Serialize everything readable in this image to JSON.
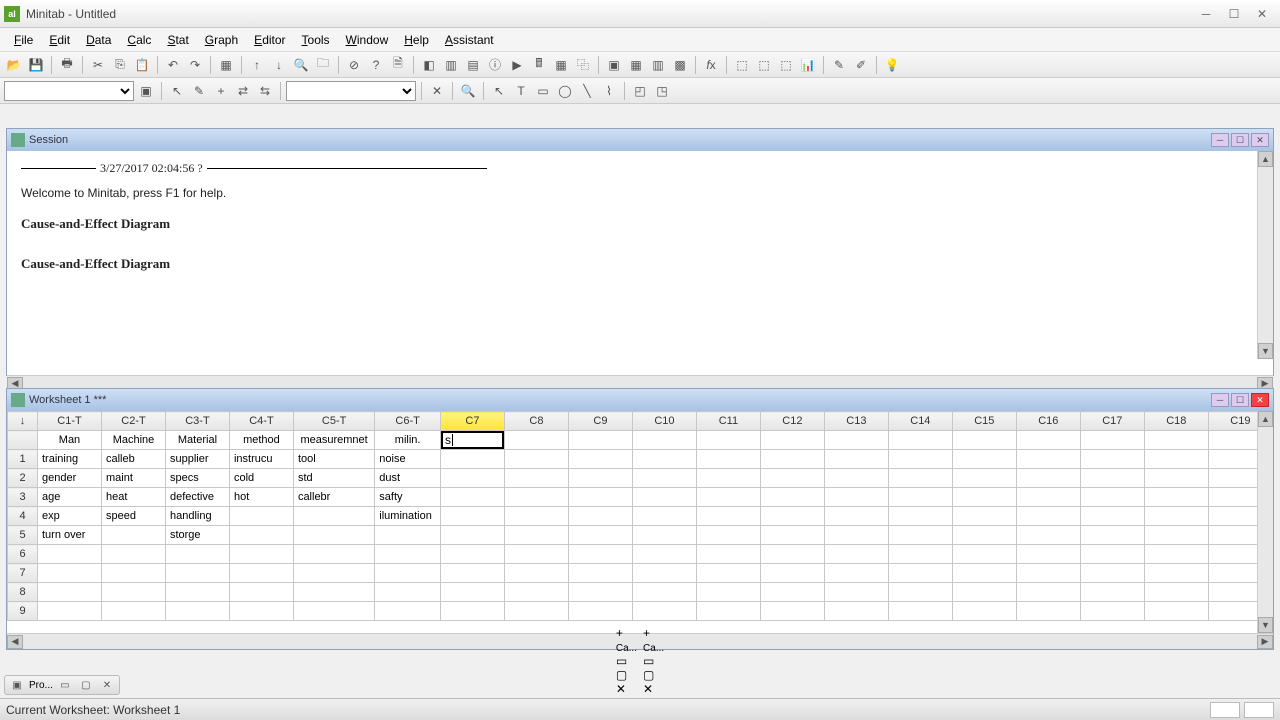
{
  "title": "Minitab - Untitled",
  "menu": [
    "File",
    "Edit",
    "Data",
    "Calc",
    "Stat",
    "Graph",
    "Editor",
    "Tools",
    "Window",
    "Help",
    "Assistant"
  ],
  "session": {
    "title": "Session",
    "timestamp": "3/27/2017 02:04:56 ?",
    "welcome": "Welcome to Minitab, press F1 for help.",
    "h1": "Cause-and-Effect Diagram",
    "h2": "Cause-and-Effect Diagram"
  },
  "worksheet": {
    "title": "Worksheet 1 ***",
    "corner": "↓",
    "colHeaders": [
      "C1-T",
      "C2-T",
      "C3-T",
      "C4-T",
      "C5-T",
      "C6-T",
      "C7",
      "C8",
      "C9",
      "C10",
      "C11",
      "C12",
      "C13",
      "C14",
      "C15",
      "C16",
      "C17",
      "C18",
      "C19"
    ],
    "colNames": [
      "Man",
      "Machine",
      "Material",
      "method",
      "measuremnet",
      "milin.",
      "",
      "",
      "",
      "",
      "",
      "",
      "",
      "",
      "",
      "",
      "",
      "",
      ""
    ],
    "editValue": "s",
    "editColIndex": 6,
    "rows": [
      [
        "training",
        "calleb",
        "supplier",
        "instrucu",
        "tool",
        "noise",
        "",
        "",
        "",
        "",
        "",
        "",
        "",
        "",
        "",
        "",
        "",
        "",
        ""
      ],
      [
        "gender",
        "maint",
        "specs",
        "cold",
        "std",
        "dust",
        "",
        "",
        "",
        "",
        "",
        "",
        "",
        "",
        "",
        "",
        "",
        "",
        ""
      ],
      [
        "age",
        "heat",
        "defective",
        "hot",
        "callebr",
        "safty",
        "",
        "",
        "",
        "",
        "",
        "",
        "",
        "",
        "",
        "",
        "",
        "",
        ""
      ],
      [
        "exp",
        "speed",
        "handling",
        "",
        "",
        "ilumination",
        "",
        "",
        "",
        "",
        "",
        "",
        "",
        "",
        "",
        "",
        "",
        "",
        ""
      ],
      [
        "turn over",
        "",
        "storge",
        "",
        "",
        "",
        "",
        "",
        "",
        "",
        "",
        "",
        "",
        "",
        "",
        "",
        "",
        "",
        ""
      ],
      [
        "",
        "",
        "",
        "",
        "",
        "",
        "",
        "",
        "",
        "",
        "",
        "",
        "",
        "",
        "",
        "",
        "",
        "",
        ""
      ],
      [
        "",
        "",
        "",
        "",
        "",
        "",
        "",
        "",
        "",
        "",
        "",
        "",
        "",
        "",
        "",
        "",
        "",
        "",
        ""
      ],
      [
        "",
        "",
        "",
        "",
        "",
        "",
        "",
        "",
        "",
        "",
        "",
        "",
        "",
        "",
        "",
        "",
        "",
        "",
        ""
      ],
      [
        "",
        "",
        "",
        "",
        "",
        "",
        "",
        "",
        "",
        "",
        "",
        "",
        "",
        "",
        "",
        "",
        "",
        "",
        ""
      ]
    ]
  },
  "bottomTabs": {
    "pro": "Pro...",
    "ca1": "Ca...",
    "ca2": "Ca..."
  },
  "status": "Current Worksheet: Worksheet 1"
}
